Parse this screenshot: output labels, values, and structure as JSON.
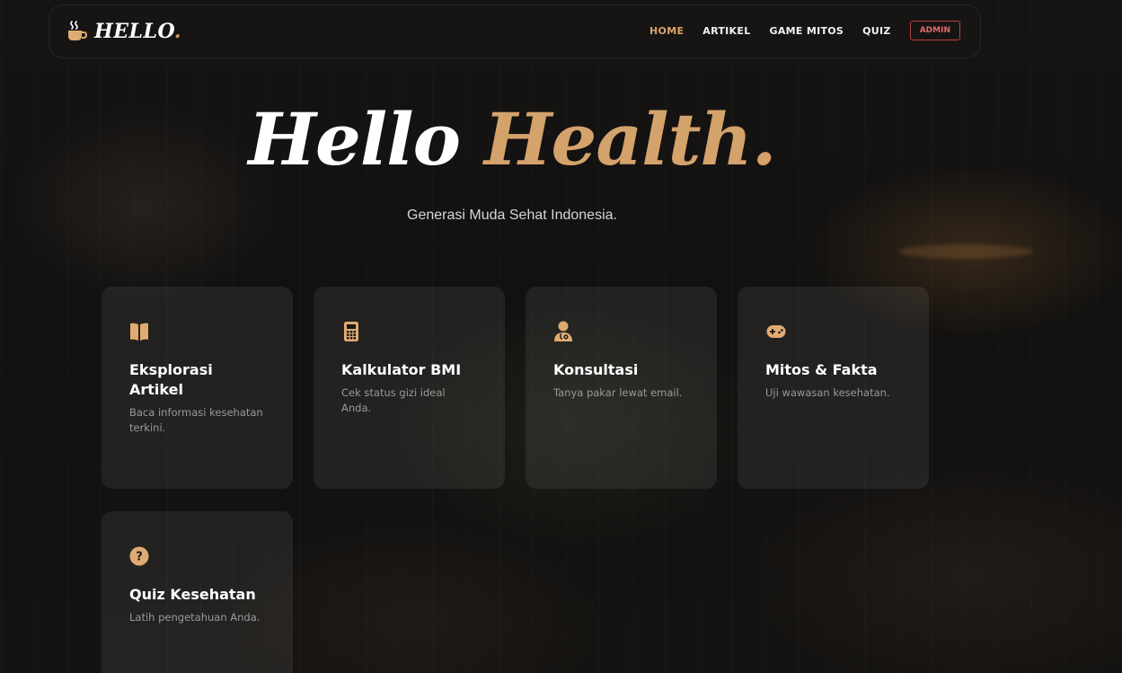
{
  "brand": {
    "text": "HELLO",
    "dot": ".",
    "icon": "coffee-cup-icon"
  },
  "nav": {
    "items": [
      {
        "label": "HOME",
        "active": true
      },
      {
        "label": "ARTIKEL",
        "active": false
      },
      {
        "label": "GAME MITOS",
        "active": false
      },
      {
        "label": "QUIZ",
        "active": false
      }
    ],
    "admin_label": "ADMIN"
  },
  "hero": {
    "title_main": "Hello",
    "title_accent": "Health",
    "title_dot": ".",
    "subtitle": "Generasi Muda Sehat Indonesia."
  },
  "cards": [
    {
      "icon": "book-open-icon",
      "title": "Eksplorasi Artikel",
      "desc": "Baca informasi kesehatan terkini."
    },
    {
      "icon": "calculator-icon",
      "title": "Kalkulator BMI",
      "desc": "Cek status gizi ideal Anda."
    },
    {
      "icon": "user-doctor-icon",
      "title": "Konsultasi",
      "desc": "Tanya pakar lewat email."
    },
    {
      "icon": "gamepad-icon",
      "title": "Mitos & Fakta",
      "desc": "Uji wawasan kesehatan."
    },
    {
      "icon": "question-circle-icon",
      "title": "Quiz Kesehatan",
      "desc": "Latih pengetahuan Anda."
    }
  ],
  "colors": {
    "accent": "#d4a26b",
    "nav_active": "#d9a46a",
    "admin": "#e46a6a",
    "icon": "#e0ab72"
  }
}
